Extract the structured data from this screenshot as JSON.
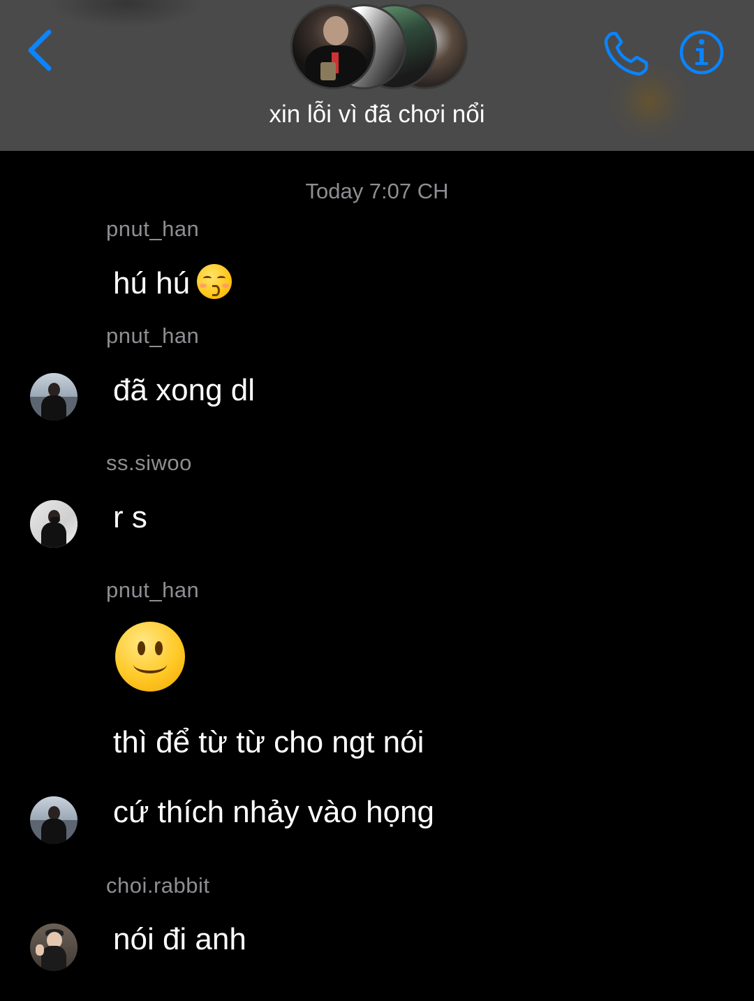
{
  "header": {
    "title": "xin lỗi vì đã chơi nổi",
    "back_icon": "chevron-left-icon",
    "call_icon": "phone-icon",
    "info_icon": "info-icon",
    "accent_color": "#0a84ff",
    "background_color": "#4a4a4a"
  },
  "conversation": {
    "timestamp": "Today 7:07 CH",
    "messages": [
      {
        "sender": "pnut_han",
        "text": "hú hú",
        "emoji": "kissing-face-emoji"
      },
      {
        "sender": "pnut_han",
        "text": "đã xong dl"
      },
      {
        "sender": "ss.siwoo",
        "text": "r s"
      },
      {
        "sender": "pnut_han",
        "emoji": "slightly-smiling-face-emoji"
      },
      {
        "text": "thì để từ từ cho ngt nói"
      },
      {
        "text": "cứ thích nhảy vào họng"
      },
      {
        "sender": "choi.rabbit",
        "text": "nói đi anh"
      }
    ]
  }
}
